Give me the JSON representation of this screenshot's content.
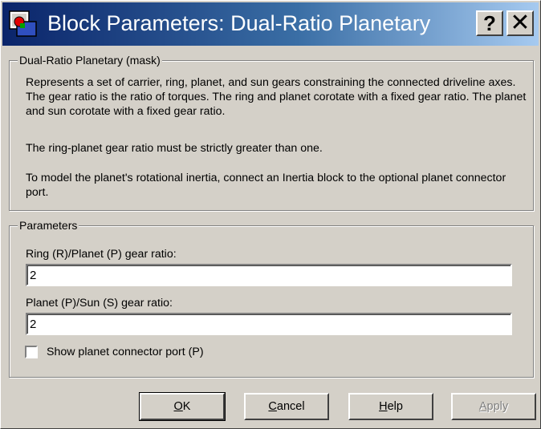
{
  "window": {
    "title": "Block Parameters: Dual-Ratio Planetary",
    "icon": "simulink-block-icon",
    "help_glyph": "?",
    "close_glyph": "✕"
  },
  "description": {
    "legend": "Dual-Ratio Planetary (mask)",
    "paragraphs": [
      "Represents a set of carrier, ring, planet, and sun gears constraining the connected driveline axes. The gear ratio is the ratio of torques. The ring and planet corotate with a fixed gear ratio. The planet and sun corotate with a fixed gear ratio.",
      "The ring-planet gear ratio must be strictly greater than one.",
      "To model the planet's rotational inertia, connect an Inertia block to the optional planet connector port."
    ]
  },
  "parameters": {
    "legend": "Parameters",
    "ring_planet_label": "Ring (R)/Planet (P) gear ratio:",
    "ring_planet_value": "2",
    "planet_sun_label": "Planet (P)/Sun (S) gear ratio:",
    "planet_sun_value": "2",
    "show_port_label": "Show planet connector port (P)",
    "show_port_checked": false
  },
  "buttons": {
    "ok_mnemonic": "O",
    "ok_rest": "K",
    "cancel_mnemonic": "C",
    "cancel_rest": "ancel",
    "help_mnemonic": "H",
    "help_rest": "elp",
    "apply_pre": "",
    "apply_mnemonic": "A",
    "apply_rest": "pply"
  }
}
